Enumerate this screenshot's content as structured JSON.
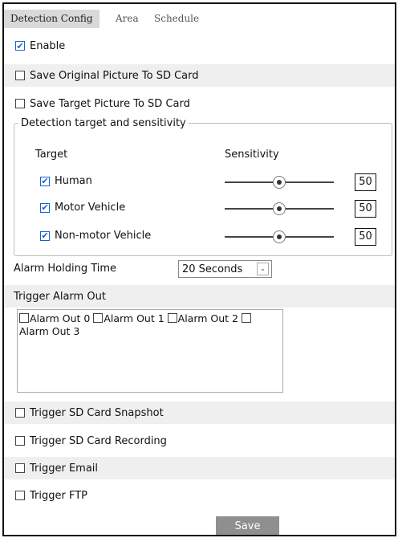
{
  "tabs": [
    {
      "label": "Detection Config",
      "active": true
    },
    {
      "label": "Area",
      "active": false
    },
    {
      "label": "Schedule",
      "active": false
    }
  ],
  "options": {
    "enable": {
      "label": "Enable",
      "checked": true
    },
    "save_original": {
      "label": "Save Original Picture To SD Card",
      "checked": false
    },
    "save_target": {
      "label": "Save Target Picture To SD Card",
      "checked": false
    }
  },
  "detection": {
    "legend": "Detection target and sensitivity",
    "col_target": "Target",
    "col_sensitivity": "Sensitivity",
    "targets": [
      {
        "label": "Human",
        "checked": true,
        "sensitivity": "50"
      },
      {
        "label": "Motor Vehicle",
        "checked": true,
        "sensitivity": "50"
      },
      {
        "label": "Non-motor Vehicle",
        "checked": true,
        "sensitivity": "50"
      }
    ]
  },
  "alarm_holding": {
    "label": "Alarm Holding Time",
    "value": "20 Seconds"
  },
  "trigger_alarm_out": {
    "label": "Trigger Alarm Out",
    "items": [
      "Alarm Out 0",
      "Alarm Out 1",
      "Alarm Out 2",
      "Alarm Out 3"
    ]
  },
  "triggers": {
    "sd_snapshot": {
      "label": "Trigger SD Card Snapshot",
      "checked": false
    },
    "sd_recording": {
      "label": "Trigger SD Card Recording",
      "checked": false
    },
    "email": {
      "label": "Trigger Email",
      "checked": false
    },
    "ftp": {
      "label": "Trigger FTP",
      "checked": false
    }
  },
  "save_label": "Save",
  "check_mark": "✔",
  "select_arrow": "⌄",
  "colors": {
    "accent": "#1a5fd6",
    "row_shade": "#efefef",
    "tab_active": "#d9d9d9",
    "button": "#8f8f8f"
  }
}
